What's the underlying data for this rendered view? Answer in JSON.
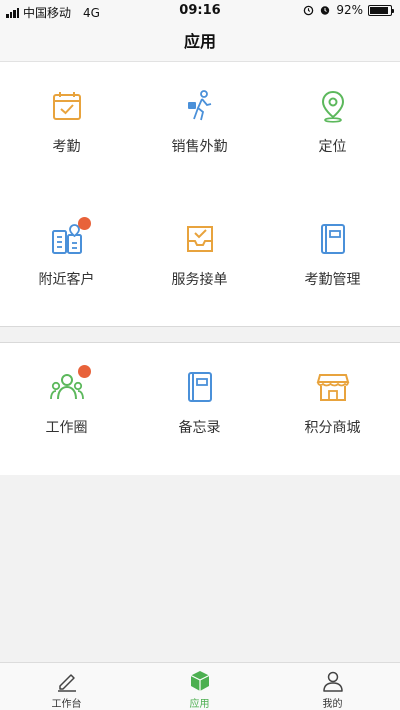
{
  "status_bar": {
    "carrier": "中国移动",
    "network": "4G",
    "time": "09:16",
    "battery": "92%",
    "battery_level": 0.92
  },
  "nav": {
    "title": "应用"
  },
  "apps_main": [
    {
      "label": "考勤",
      "icon": "attendance-calendar-icon"
    },
    {
      "label": "销售外勤",
      "icon": "walking-person-icon"
    },
    {
      "label": "定位",
      "icon": "location-pin-icon"
    },
    {
      "label": "附近客户",
      "icon": "nearby-customers-icon",
      "badge": true
    },
    {
      "label": "服务接单",
      "icon": "inbox-check-icon"
    },
    {
      "label": "考勤管理",
      "icon": "book-icon"
    }
  ],
  "apps_secondary": [
    {
      "label": "工作圈",
      "icon": "people-circle-icon",
      "badge": true
    },
    {
      "label": "备忘录",
      "icon": "notebook-icon"
    },
    {
      "label": "积分商城",
      "icon": "storefront-icon"
    }
  ],
  "tabs": [
    {
      "label": "工作台",
      "icon": "pencil-icon",
      "active": false
    },
    {
      "label": "应用",
      "icon": "cube-icon",
      "active": true
    },
    {
      "label": "我的",
      "icon": "person-icon",
      "active": false
    }
  ],
  "colors": {
    "orange": "#e8a33d",
    "blue": "#4a90d9",
    "green": "#5cb85c",
    "badge": "#e8623a",
    "active_tab": "#4caf50"
  }
}
